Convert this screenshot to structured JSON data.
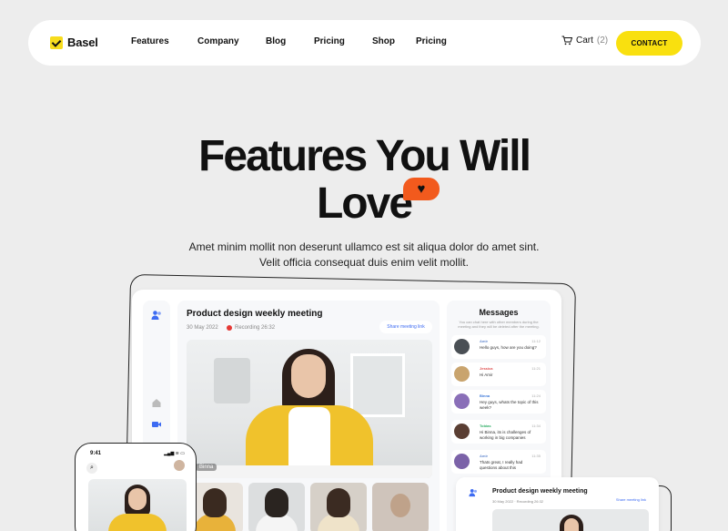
{
  "nav": {
    "brand": "Basel",
    "links": [
      "Features",
      "Company",
      "Blog",
      "Pricing",
      "Shop",
      "Pricing"
    ],
    "cart_label": "Cart",
    "cart_count": "(2)",
    "contact_label": "CONTACT"
  },
  "hero": {
    "title_line1": "Features You Will",
    "title_line2": "Love",
    "subtitle_line1": "Amet minim mollit non deserunt ullamco est sit aliqua dolor do amet sint.",
    "subtitle_line2": "Velit officia consequat duis enim velit mollit."
  },
  "meeting": {
    "title": "Product design weekly meeting",
    "date": "30 May 2022",
    "recording": "Recording 26:32",
    "share_label": "Share meeting link",
    "speaker_name": "Binna"
  },
  "messages": {
    "title": "Messages",
    "description": "You can chat here with other members during the meeting and they will be deleted after the meeting.",
    "items": [
      {
        "name": "Amir",
        "time": "11:12",
        "text": "Hello guys, how are you doing?",
        "color": "#6a8ed1"
      },
      {
        "name": "Jessica",
        "time": "11:21",
        "text": "Hi Amir",
        "color": "#e05252"
      },
      {
        "name": "Binna",
        "time": "11:24",
        "text": "Hey guys, whats the topic of this week?",
        "color": "#3f7ad9"
      },
      {
        "name": "Tobias",
        "time": "11:34",
        "text": "Hi Binna, its is challenges of working in big companies",
        "color": "#2fae65"
      },
      {
        "name": "Amir",
        "time": "11:35",
        "text": "Thats great, I really had questions about this",
        "color": "#6a8ed1"
      }
    ]
  },
  "phone": {
    "time": "9:41",
    "status": "▂▄▆ ≋ ▭"
  },
  "small_card": {
    "title": "Product design weekly meeting",
    "date": "30 May 2022 · Recording 26:32",
    "share_label": "Share meeting link"
  }
}
